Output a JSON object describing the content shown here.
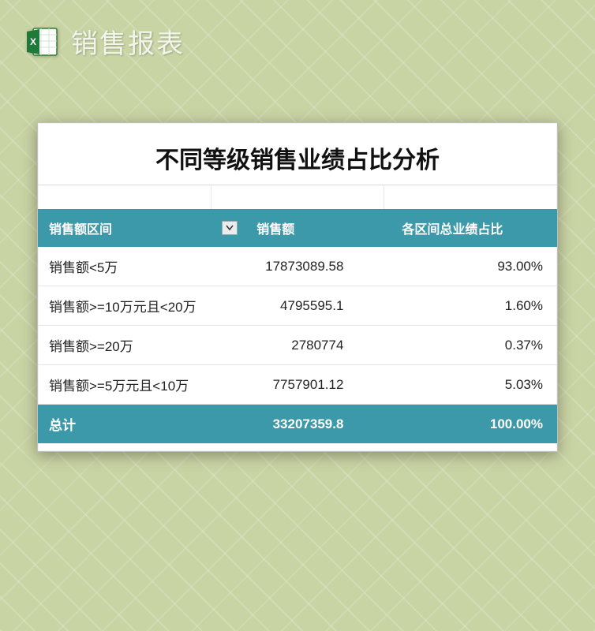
{
  "header": {
    "page_title": "销售报表"
  },
  "card": {
    "title": "不同等级销售业绩占比分析"
  },
  "table": {
    "columns": {
      "range": "销售额区间",
      "amount": "销售额",
      "pct": "各区间总业绩占比"
    },
    "rows": [
      {
        "range": "销售额<5万",
        "amount": "17873089.58",
        "pct": "93.00%"
      },
      {
        "range": "销售额>=10万元且<20万",
        "amount": "4795595.1",
        "pct": "1.60%"
      },
      {
        "range": "销售额>=20万",
        "amount": "2780774",
        "pct": "0.37%"
      },
      {
        "range": "销售额>=5万元且<10万",
        "amount": "7757901.12",
        "pct": "5.03%"
      }
    ],
    "total": {
      "label": "总计",
      "amount": "33207359.8",
      "pct": "100.00%"
    }
  }
}
